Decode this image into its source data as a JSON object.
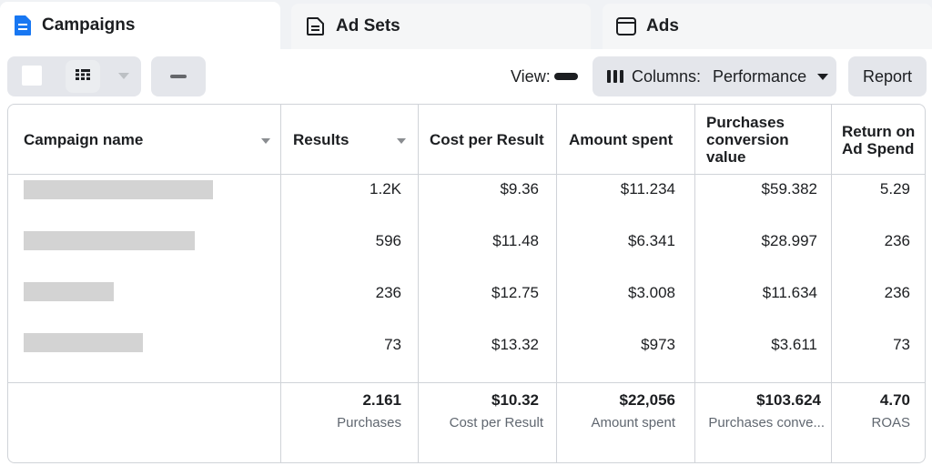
{
  "tabs": [
    {
      "label": "Campaigns",
      "active": true,
      "icon": "campaign-doc-icon"
    },
    {
      "label": "Ad Sets",
      "active": false,
      "icon": "adset-doc-icon"
    },
    {
      "label": "Ads",
      "active": false,
      "icon": "ad-window-icon"
    }
  ],
  "toolbar": {
    "view_label": "View:",
    "columns_label": "Columns:",
    "columns_value": "Performance",
    "report_label": "Report"
  },
  "table": {
    "headers": {
      "name": "Campaign name",
      "results": "Results",
      "cost": "Cost per Result",
      "spent": "Amount spent",
      "conv_line1": "Purchases",
      "conv_line2": "conversion",
      "conv_line3": "value",
      "roas_line1": "Return on",
      "roas_line2": "Ad Spend"
    },
    "rows": [
      {
        "results": "1.2K",
        "cost": "$9.36",
        "spent": "$11.234",
        "conv": "$59.382",
        "roas": "5.29"
      },
      {
        "results": "596",
        "cost": "$11.48",
        "spent": "$6.341",
        "conv": "$28.997",
        "roas": "236"
      },
      {
        "results": "236",
        "cost": "$12.75",
        "spent": "$3.008",
        "conv": "$11.634",
        "roas": "236"
      },
      {
        "results": "73",
        "cost": "$13.32",
        "spent": "$973",
        "conv": "$3.611",
        "roas": "73"
      }
    ],
    "totals": {
      "results": "2.161",
      "results_sub": "Purchases",
      "cost": "$10.32",
      "cost_sub": "Cost per Result",
      "spent": "$22,056",
      "spent_sub": "Amount spent",
      "conv": "$103.624",
      "conv_sub": "Purchases conve...",
      "roas": "4.70",
      "roas_sub": "ROAS"
    }
  },
  "colors": {
    "accent": "#1877f2",
    "redacted_bar": "#d3d3d3"
  }
}
